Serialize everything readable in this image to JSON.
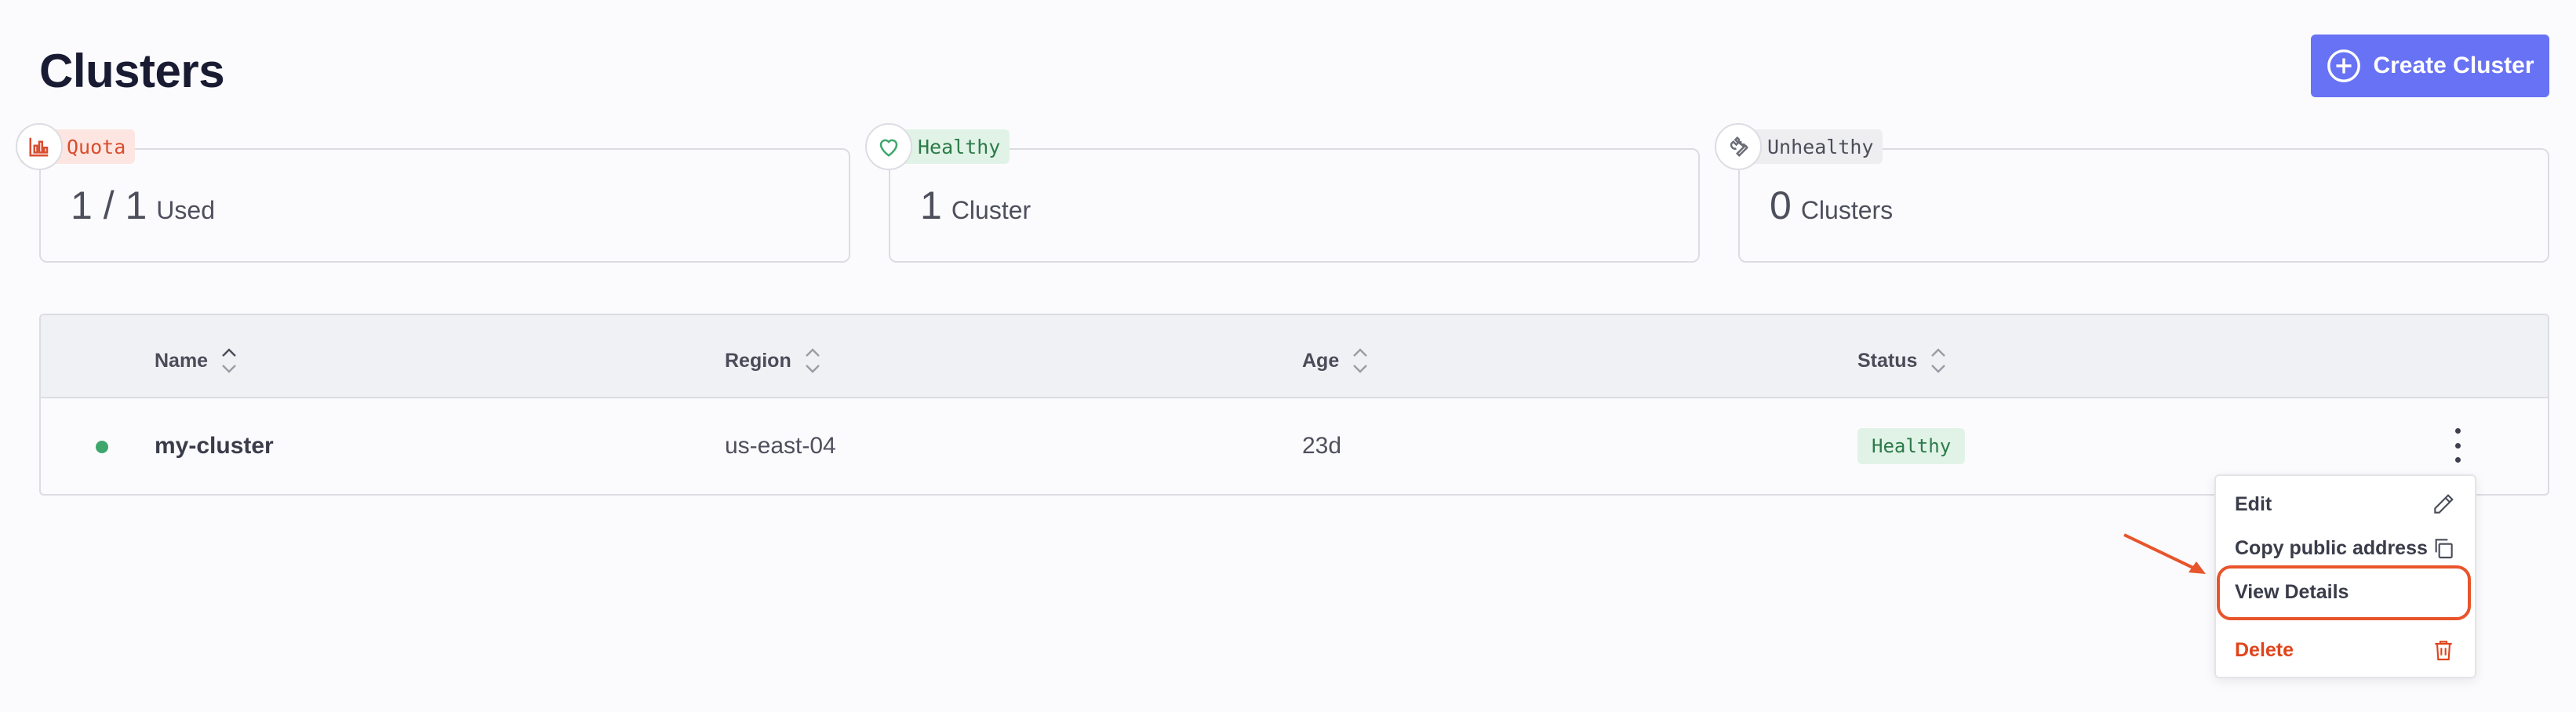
{
  "header": {
    "title": "Clusters",
    "create_button_label": "Create Cluster"
  },
  "stats": {
    "quota": {
      "tag": "Quota",
      "value": "1 / 1",
      "unit": "Used",
      "color": "#d94d2e",
      "bg": "#fde6e1"
    },
    "healthy": {
      "tag": "Healthy",
      "value": "1",
      "unit": "Cluster",
      "color": "#2c7a48",
      "bg": "#e1f3e7"
    },
    "unhealthy": {
      "tag": "Unhealthy",
      "value": "0",
      "unit": "Clusters",
      "color": "#4b4d59",
      "bg": "#eeeef1"
    }
  },
  "table": {
    "columns": [
      "Name",
      "Region",
      "Age",
      "Status"
    ],
    "rows": [
      {
        "name": "my-cluster",
        "region": "us-east-04",
        "age": "23d",
        "status": "Healthy"
      }
    ]
  },
  "row_menu": {
    "items": [
      {
        "label": "Edit",
        "icon": "pencil-icon"
      },
      {
        "label": "Copy public address",
        "icon": "copy-icon"
      },
      {
        "label": "View Details",
        "icon": ""
      },
      {
        "label": "Delete",
        "icon": "trash-icon"
      }
    ]
  },
  "colors": {
    "accent": "#6772f4",
    "danger": "#e0441b",
    "success": "#3fa66c",
    "annotation": "#e8542b"
  }
}
